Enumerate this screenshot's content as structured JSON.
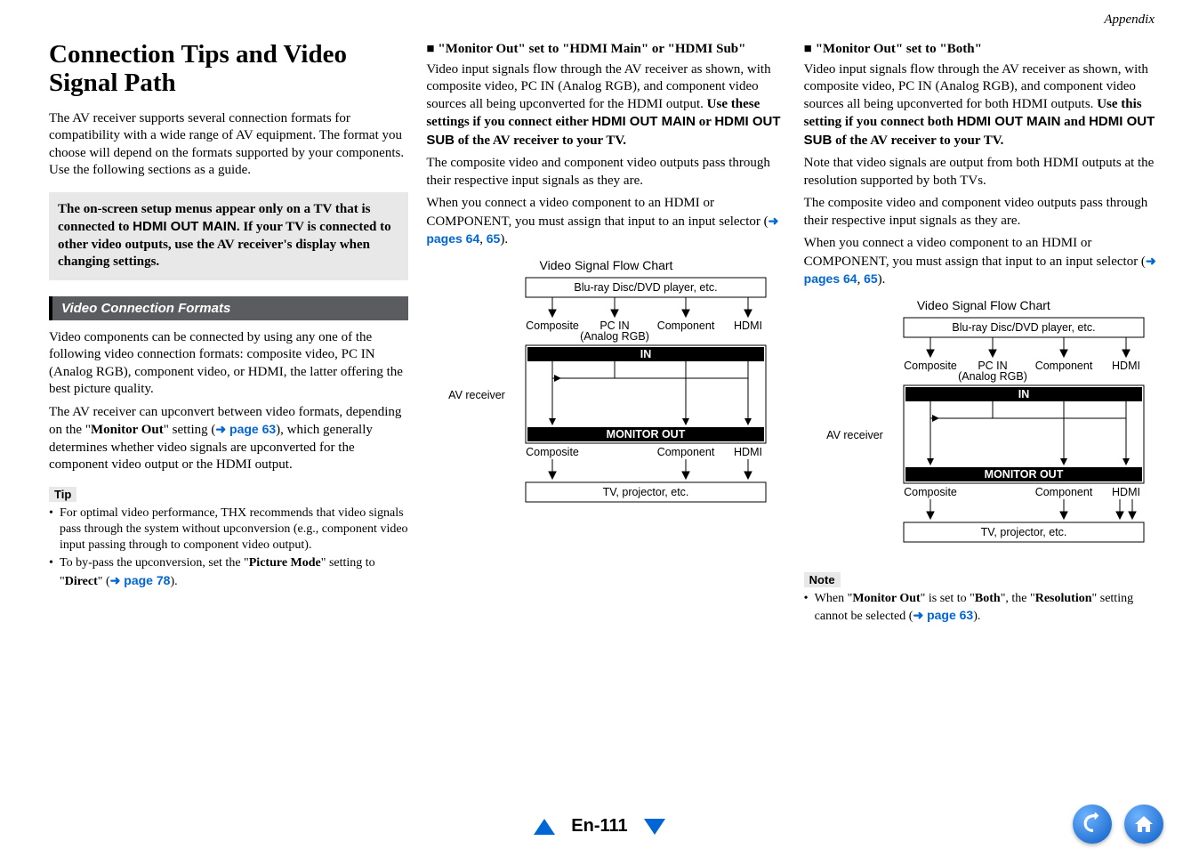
{
  "appendix": "Appendix",
  "col1": {
    "h1": "Connection Tips and Video Signal Path",
    "intro": "The AV receiver supports several connection formats for compatibility with a wide range of AV equipment. The format you choose will depend on the formats supported by your components. Use the following sections as a guide.",
    "callout_a": "The on-screen setup menus appear only on a TV that is connected to ",
    "callout_b": "HDMI OUT MAIN",
    "callout_c": ". If your TV is connected to other video outputs, use the AV receiver's display when changing settings.",
    "section_bar": "Video Connection Formats",
    "p2": "Video components can be connected by using any one of the following video connection formats: composite video, PC IN (Analog RGB), component video, or HDMI, the latter offering the best picture quality.",
    "p3a": "The AV receiver can upconvert between video formats, depending on the \"",
    "p3b": "Monitor Out",
    "p3c": "\" setting (",
    "p3_link": "page 63",
    "p3d": "), which generally determines whether video signals are upconverted for the component video output or the HDMI output.",
    "tip_label": "Tip",
    "tip1": "For optimal video performance, THX recommends that video signals pass through the system without upconversion (e.g., component video input passing through to component video output).",
    "tip2a": "To by-pass the upconversion, set the \"",
    "tip2b": "Picture Mode",
    "tip2c": "\" setting to \"",
    "tip2d": "Direct",
    "tip2e": "\" (",
    "tip2_link": "page 78",
    "tip2f": ")."
  },
  "col2": {
    "h": "\"Monitor Out\" set to \"HDMI Main\" or \"HDMI Sub\"",
    "p1a": "Video input signals flow through the AV receiver as shown, with composite video, PC IN (Analog RGB), and component video sources all being upconverted for the HDMI output. ",
    "p1b": "Use these settings if you connect either ",
    "p1c": "HDMI OUT MAIN",
    "p1d": " or ",
    "p1e": "HDMI OUT SUB",
    "p1f": " of the AV receiver to your TV.",
    "p2": "The composite video and component video outputs pass through their respective input signals as they are.",
    "p3a": "When you connect a video component to an HDMI or COMPONENT, you must assign that input to an input selector (",
    "p3_link1": "pages 64",
    "p3_link2": "65",
    "p3b": ").",
    "flow_title": "Video Signal Flow Chart"
  },
  "col3": {
    "h": "\"Monitor Out\" set to \"Both\"",
    "p1a": "Video input signals flow through the AV receiver as shown, with composite video, PC IN (Analog RGB), and component video sources all being upconverted for both HDMI outputs. ",
    "p1b": "Use this setting if you connect both ",
    "p1c": "HDMI OUT MAIN",
    "p1d": " and ",
    "p1e": "HDMI OUT SUB",
    "p1f": " of the AV receiver to your TV.",
    "p1g": "Note that video signals are output from both HDMI outputs at the resolution supported by both TVs.",
    "p2": "The composite video and component video outputs pass through their respective input signals as they are.",
    "p3a": "When you connect a video component to an HDMI or COMPONENT, you must assign that input to an input selector (",
    "p3_link1": "pages 64",
    "p3_link2": "65",
    "p3b": ").",
    "flow_title": "Video Signal Flow Chart",
    "note_label": "Note",
    "note_a": "When \"",
    "note_b": "Monitor Out",
    "note_c": "\" is set to \"",
    "note_d": "Both",
    "note_e": "\", the \"",
    "note_f": "Resolution",
    "note_g": "\" setting cannot be selected (",
    "note_link": "page 63",
    "note_h": ")."
  },
  "diagram": {
    "source": "Blu-ray Disc/DVD player, etc.",
    "composite": "Composite",
    "pcin1": "PC IN",
    "pcin2": "(Analog RGB)",
    "component": "Component",
    "hdmi": "HDMI",
    "in": "IN",
    "monitor_out": "MONITOR OUT",
    "avreceiver": "AV receiver",
    "sink": "TV, projector, etc."
  },
  "footer": {
    "page": "En-111"
  }
}
